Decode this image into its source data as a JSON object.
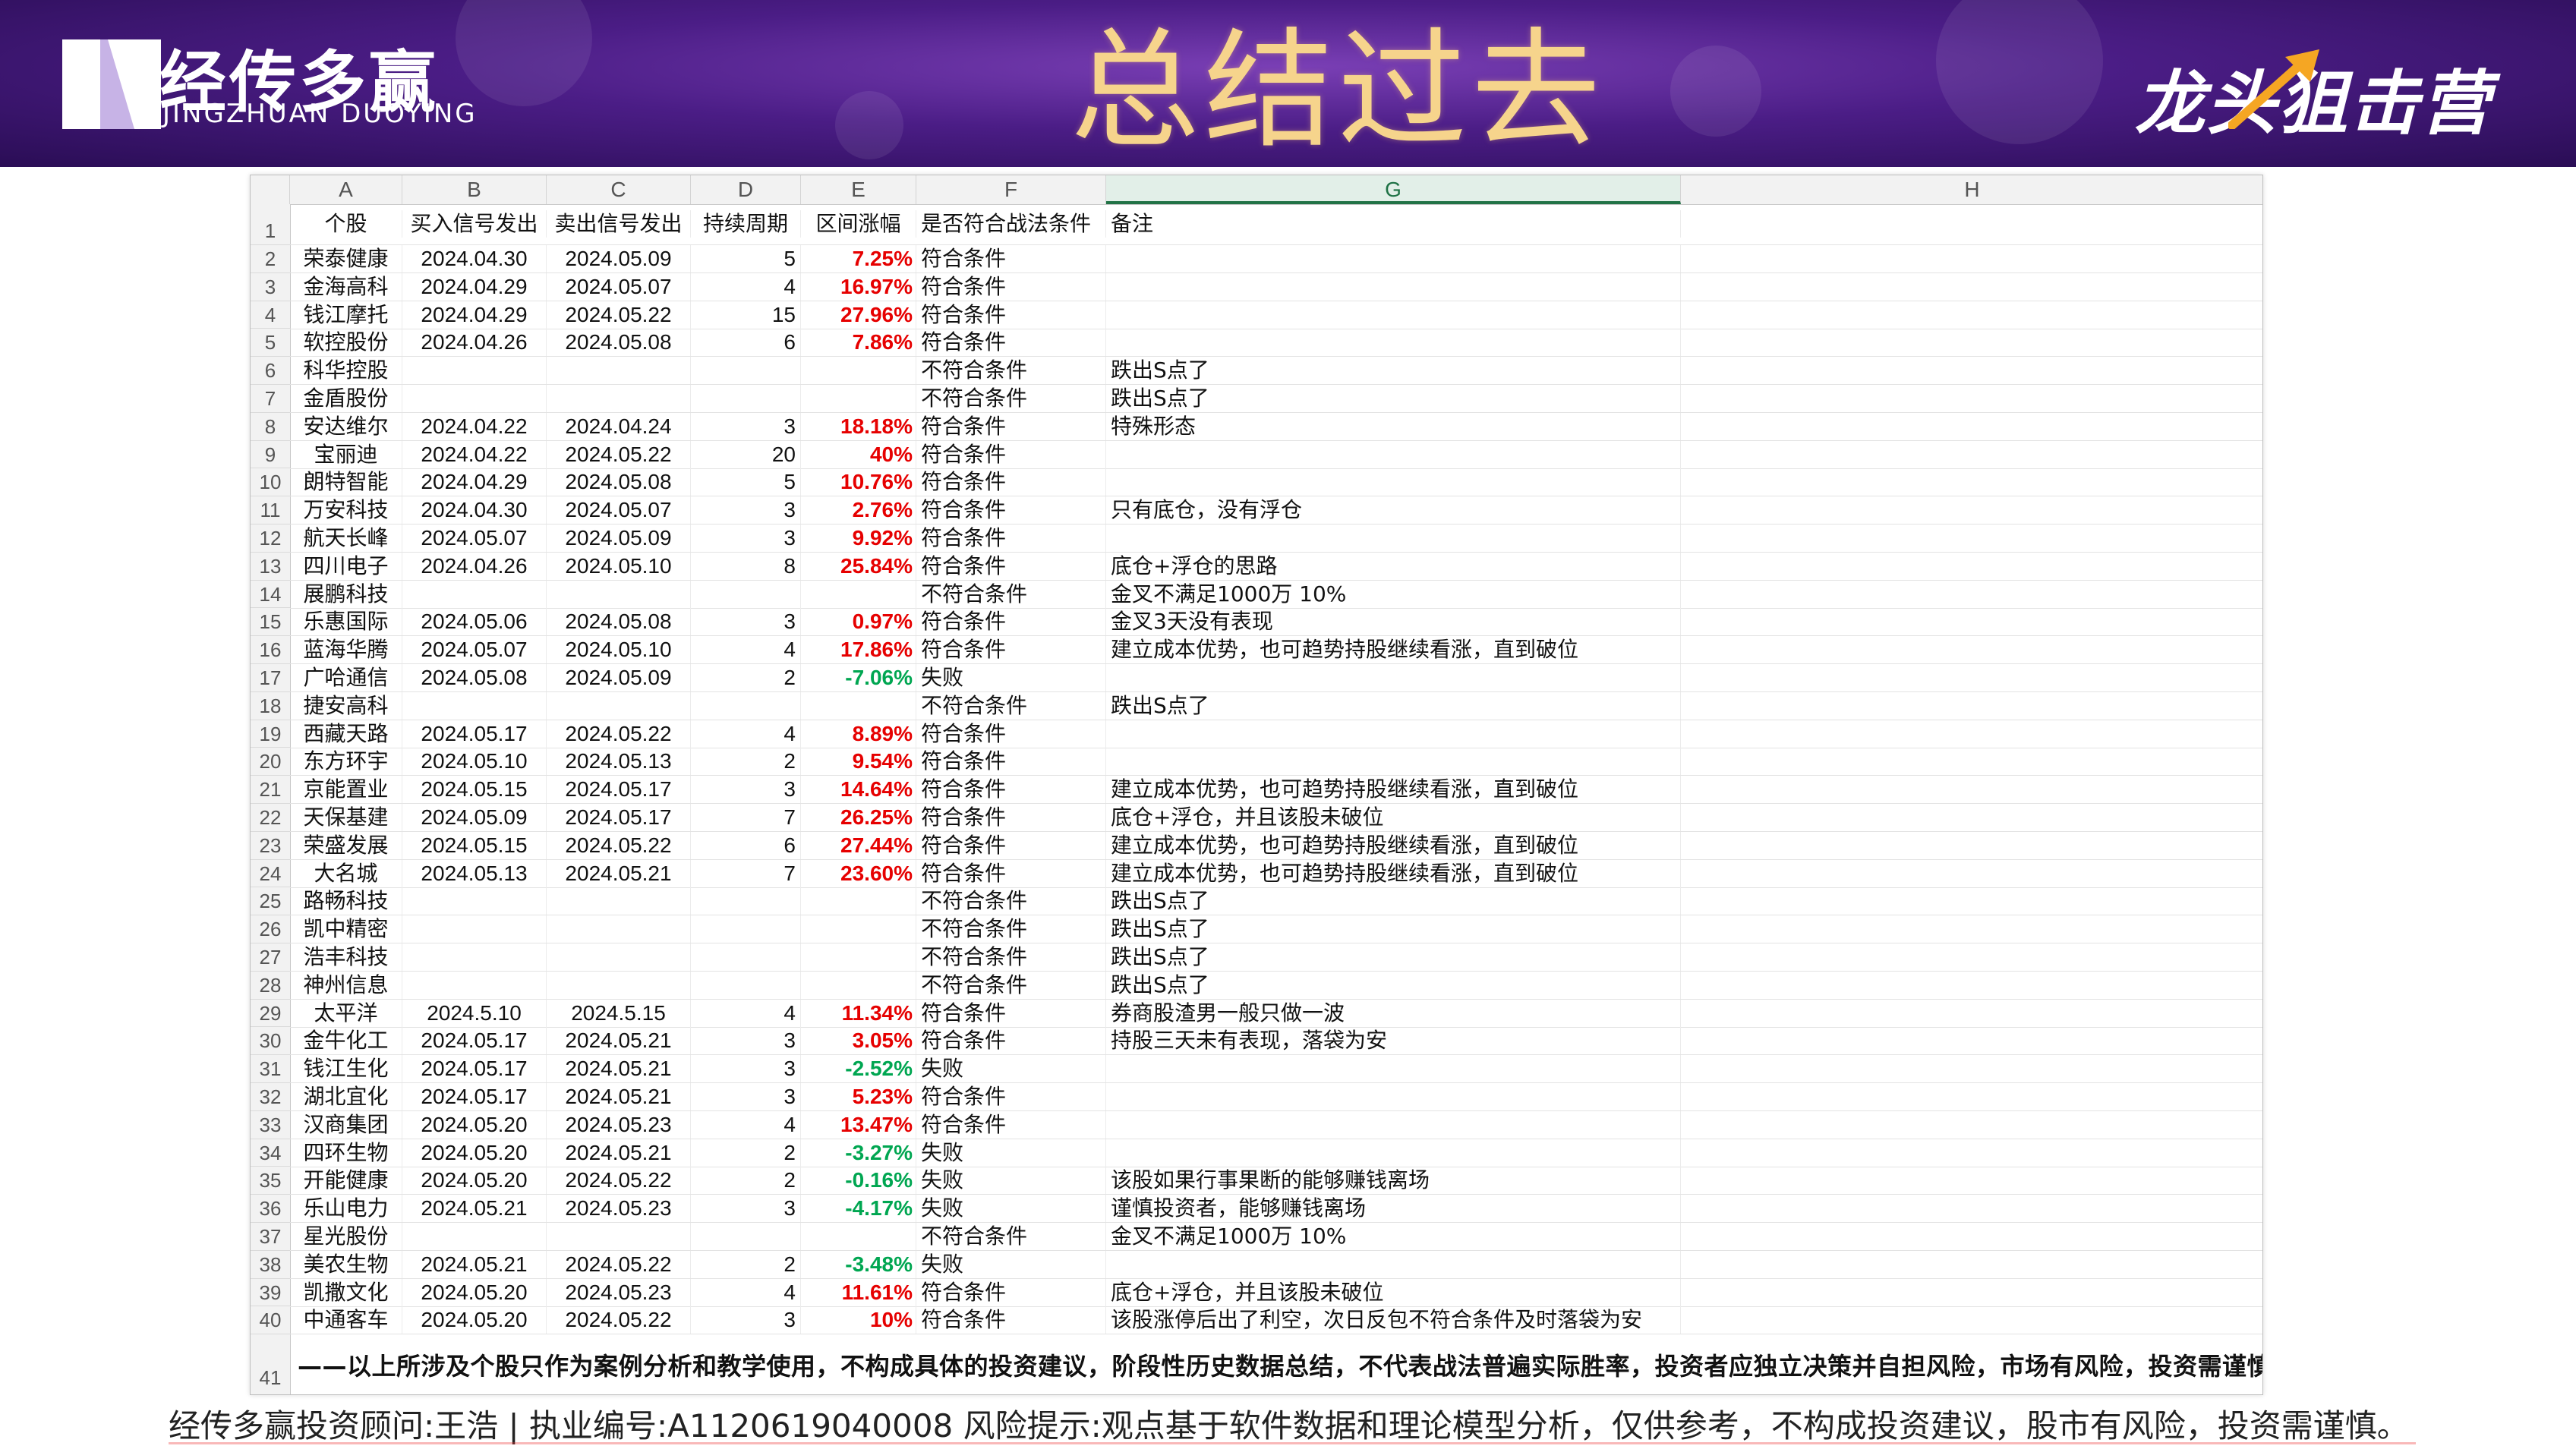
{
  "header": {
    "brand_cn": "经传多赢",
    "brand_en": "JINGZHUAN DUOYING",
    "title": "总结过去",
    "campaign": "龙头狙击营"
  },
  "sheet": {
    "columns": [
      "A",
      "B",
      "C",
      "D",
      "E",
      "F",
      "G",
      "H"
    ],
    "active_column": "G",
    "headers": {
      "name": "个股",
      "buy": "买入信号发出",
      "sell": "卖出信号发出",
      "period": "持续周期",
      "gain": "区间涨幅",
      "qualify": "是否符合战法条件",
      "note": "备注"
    },
    "rows": [
      {
        "n": "2",
        "name": "荣泰健康",
        "buy": "2024.04.30",
        "sell": "2024.05.09",
        "period": "5",
        "gain": "7.25%",
        "sign": "pos",
        "qualify": "符合条件",
        "note": ""
      },
      {
        "n": "3",
        "name": "金海高科",
        "buy": "2024.04.29",
        "sell": "2024.05.07",
        "period": "4",
        "gain": "16.97%",
        "sign": "pos",
        "qualify": "符合条件",
        "note": ""
      },
      {
        "n": "4",
        "name": "钱江摩托",
        "buy": "2024.04.29",
        "sell": "2024.05.22",
        "period": "15",
        "gain": "27.96%",
        "sign": "pos",
        "qualify": "符合条件",
        "note": ""
      },
      {
        "n": "5",
        "name": "软控股份",
        "buy": "2024.04.26",
        "sell": "2024.05.08",
        "period": "6",
        "gain": "7.86%",
        "sign": "pos",
        "qualify": "符合条件",
        "note": ""
      },
      {
        "n": "6",
        "name": "科华控股",
        "buy": "",
        "sell": "",
        "period": "",
        "gain": "",
        "sign": "",
        "qualify": "不符合条件",
        "note": "跌出S点了"
      },
      {
        "n": "7",
        "name": "金盾股份",
        "buy": "",
        "sell": "",
        "period": "",
        "gain": "",
        "sign": "",
        "qualify": "不符合条件",
        "note": "跌出S点了"
      },
      {
        "n": "8",
        "name": "安达维尔",
        "buy": "2024.04.22",
        "sell": "2024.04.24",
        "period": "3",
        "gain": "18.18%",
        "sign": "pos",
        "qualify": "符合条件",
        "note": "特殊形态"
      },
      {
        "n": "9",
        "name": "宝丽迪",
        "buy": "2024.04.22",
        "sell": "2024.05.22",
        "period": "20",
        "gain": "40%",
        "sign": "pos",
        "qualify": "符合条件",
        "note": ""
      },
      {
        "n": "10",
        "name": "朗特智能",
        "buy": "2024.04.29",
        "sell": "2024.05.08",
        "period": "5",
        "gain": "10.76%",
        "sign": "pos",
        "qualify": "符合条件",
        "note": ""
      },
      {
        "n": "11",
        "name": "万安科技",
        "buy": "2024.04.30",
        "sell": "2024.05.07",
        "period": "3",
        "gain": "2.76%",
        "sign": "pos",
        "qualify": "符合条件",
        "note": "只有底仓，没有浮仓"
      },
      {
        "n": "12",
        "name": "航天长峰",
        "buy": "2024.05.07",
        "sell": "2024.05.09",
        "period": "3",
        "gain": "9.92%",
        "sign": "pos",
        "qualify": "符合条件",
        "note": ""
      },
      {
        "n": "13",
        "name": "四川电子",
        "buy": "2024.04.26",
        "sell": "2024.05.10",
        "period": "8",
        "gain": "25.84%",
        "sign": "pos",
        "qualify": "符合条件",
        "note": "底仓+浮仓的思路"
      },
      {
        "n": "14",
        "name": "展鹏科技",
        "buy": "",
        "sell": "",
        "period": "",
        "gain": "",
        "sign": "",
        "qualify": "不符合条件",
        "note": "金叉不满足1000万   10%"
      },
      {
        "n": "15",
        "name": "乐惠国际",
        "buy": "2024.05.06",
        "sell": "2024.05.08",
        "period": "3",
        "gain": "0.97%",
        "sign": "pos",
        "qualify": "符合条件",
        "note": "金叉3天没有表现"
      },
      {
        "n": "16",
        "name": "蓝海华腾",
        "buy": "2024.05.07",
        "sell": "2024.05.10",
        "period": "4",
        "gain": "17.86%",
        "sign": "pos",
        "qualify": "符合条件",
        "note": "建立成本优势，也可趋势持股继续看涨，直到破位"
      },
      {
        "n": "17",
        "name": "广哈通信",
        "buy": "2024.05.08",
        "sell": "2024.05.09",
        "period": "2",
        "gain": "-7.06%",
        "sign": "neg",
        "qualify": "失败",
        "note": ""
      },
      {
        "n": "18",
        "name": "捷安高科",
        "buy": "",
        "sell": "",
        "period": "",
        "gain": "",
        "sign": "",
        "qualify": "不符合条件",
        "note": "跌出S点了"
      },
      {
        "n": "19",
        "name": "西藏天路",
        "buy": "2024.05.17",
        "sell": "2024.05.22",
        "period": "4",
        "gain": "8.89%",
        "sign": "pos",
        "qualify": "符合条件",
        "note": ""
      },
      {
        "n": "20",
        "name": "东方环宇",
        "buy": "2024.05.10",
        "sell": "2024.05.13",
        "period": "2",
        "gain": "9.54%",
        "sign": "pos",
        "qualify": "符合条件",
        "note": ""
      },
      {
        "n": "21",
        "name": "京能置业",
        "buy": "2024.05.15",
        "sell": "2024.05.17",
        "period": "3",
        "gain": "14.64%",
        "sign": "pos",
        "qualify": "符合条件",
        "note": "建立成本优势，也可趋势持股继续看涨，直到破位"
      },
      {
        "n": "22",
        "name": "天保基建",
        "buy": "2024.05.09",
        "sell": "2024.05.17",
        "period": "7",
        "gain": "26.25%",
        "sign": "pos",
        "qualify": "符合条件",
        "note": "底仓+浮仓，并且该股未破位"
      },
      {
        "n": "23",
        "name": "荣盛发展",
        "buy": "2024.05.15",
        "sell": "2024.05.22",
        "period": "6",
        "gain": "27.44%",
        "sign": "pos",
        "qualify": "符合条件",
        "note": "建立成本优势，也可趋势持股继续看涨，直到破位"
      },
      {
        "n": "24",
        "name": "大名城",
        "buy": "2024.05.13",
        "sell": "2024.05.21",
        "period": "7",
        "gain": "23.60%",
        "sign": "pos",
        "qualify": "符合条件",
        "note": "建立成本优势，也可趋势持股继续看涨，直到破位"
      },
      {
        "n": "25",
        "name": "路畅科技",
        "buy": "",
        "sell": "",
        "period": "",
        "gain": "",
        "sign": "",
        "qualify": "不符合条件",
        "note": "跌出S点了"
      },
      {
        "n": "26",
        "name": "凯中精密",
        "buy": "",
        "sell": "",
        "period": "",
        "gain": "",
        "sign": "",
        "qualify": "不符合条件",
        "note": "跌出S点了"
      },
      {
        "n": "27",
        "name": "浩丰科技",
        "buy": "",
        "sell": "",
        "period": "",
        "gain": "",
        "sign": "",
        "qualify": "不符合条件",
        "note": "跌出S点了"
      },
      {
        "n": "28",
        "name": "神州信息",
        "buy": "",
        "sell": "",
        "period": "",
        "gain": "",
        "sign": "",
        "qualify": "不符合条件",
        "note": "跌出S点了"
      },
      {
        "n": "29",
        "name": "太平洋",
        "buy": "2024.5.10",
        "sell": "2024.5.15",
        "period": "4",
        "gain": "11.34%",
        "sign": "pos",
        "qualify": "符合条件",
        "note": "券商股渣男一般只做一波"
      },
      {
        "n": "30",
        "name": "金牛化工",
        "buy": "2024.05.17",
        "sell": "2024.05.21",
        "period": "3",
        "gain": "3.05%",
        "sign": "pos",
        "qualify": "符合条件",
        "note": "持股三天未有表现，落袋为安"
      },
      {
        "n": "31",
        "name": "钱江生化",
        "buy": "2024.05.17",
        "sell": "2024.05.21",
        "period": "3",
        "gain": "-2.52%",
        "sign": "neg",
        "qualify": "失败",
        "note": ""
      },
      {
        "n": "32",
        "name": "湖北宜化",
        "buy": "2024.05.17",
        "sell": "2024.05.21",
        "period": "3",
        "gain": "5.23%",
        "sign": "pos",
        "qualify": "符合条件",
        "note": ""
      },
      {
        "n": "33",
        "name": "汉商集团",
        "buy": "2024.05.20",
        "sell": "2024.05.23",
        "period": "4",
        "gain": "13.47%",
        "sign": "pos",
        "qualify": "符合条件",
        "note": ""
      },
      {
        "n": "34",
        "name": "四环生物",
        "buy": "2024.05.20",
        "sell": "2024.05.21",
        "period": "2",
        "gain": "-3.27%",
        "sign": "neg",
        "qualify": "失败",
        "note": ""
      },
      {
        "n": "35",
        "name": "开能健康",
        "buy": "2024.05.20",
        "sell": "2024.05.22",
        "period": "2",
        "gain": "-0.16%",
        "sign": "neg",
        "qualify": "失败",
        "note": "该股如果行事果断的能够赚钱离场"
      },
      {
        "n": "36",
        "name": "乐山电力",
        "buy": "2024.05.21",
        "sell": "2024.05.23",
        "period": "3",
        "gain": "-4.17%",
        "sign": "neg",
        "qualify": "失败",
        "note": "谨慎投资者，能够赚钱离场"
      },
      {
        "n": "37",
        "name": "星光股份",
        "buy": "",
        "sell": "",
        "period": "",
        "gain": "",
        "sign": "",
        "qualify": "不符合条件",
        "note": "金叉不满足1000万   10%"
      },
      {
        "n": "38",
        "name": "美农生物",
        "buy": "2024.05.21",
        "sell": "2024.05.22",
        "period": "2",
        "gain": "-3.48%",
        "sign": "neg",
        "qualify": "失败",
        "note": ""
      },
      {
        "n": "39",
        "name": "凯撒文化",
        "buy": "2024.05.20",
        "sell": "2024.05.23",
        "period": "4",
        "gain": "11.61%",
        "sign": "pos",
        "qualify": "符合条件",
        "note": "底仓+浮仓，并且该股未破位"
      },
      {
        "n": "40",
        "name": "中通客车",
        "buy": "2024.05.20",
        "sell": "2024.05.22",
        "period": "3",
        "gain": "10%",
        "sign": "pos",
        "qualify": "符合条件",
        "note": "该股涨停后出了利空，次日反包不符合条件及时落袋为安"
      }
    ],
    "row_header_label": "1",
    "last_row_label": "41",
    "disclaimer": "——以上所涉及个股只作为案例分析和教学使用，不构成具体的投资建议，阶段性历史数据总结，不代表战法普遍实际胜率，投资者应独立决策并自担风险，市场有风险，投资需谨慎！"
  },
  "footer": {
    "text": "经传多赢投资顾问:王浩 | 执业编号:A1120619040008  风险提示:观点基于软件数据和理论模型分析，仅供参考，不构成投资建议，股市有风险，投资需谨慎。"
  },
  "colors": {
    "positive": "#e60000",
    "negative": "#00a651",
    "title_gold": "#f6d48c",
    "banner_purple": "#4b1d86",
    "accent_orange": "#f5a623"
  }
}
